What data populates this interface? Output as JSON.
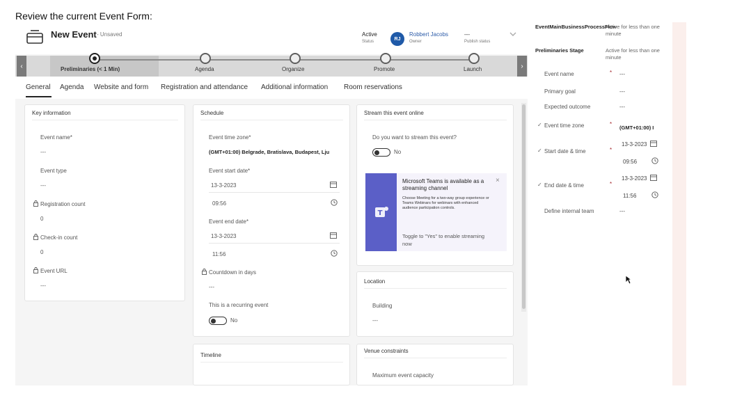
{
  "caption": "Review the current Event Form:",
  "header": {
    "title": "New Event",
    "unsaved": "- Unsaved",
    "status_value": "Active",
    "status_label": "Status",
    "avatar_initials": "RJ",
    "owner_name": "Robbert Jacobs",
    "owner_label": "Owner",
    "publish_value": "---",
    "publish_label": "Publish status"
  },
  "bpf": {
    "stages": [
      {
        "label": "Preliminaries  (< 1 Min)",
        "active": true
      },
      {
        "label": "Agenda",
        "active": false
      },
      {
        "label": "Organize",
        "active": false
      },
      {
        "label": "Promote",
        "active": false
      },
      {
        "label": "Launch",
        "active": false
      }
    ]
  },
  "tabs": [
    "General",
    "Agenda",
    "Website and form",
    "Registration and attendance",
    "Additional information",
    "Room reservations"
  ],
  "key_info": {
    "title": "Key information",
    "event_name_label": "Event name*",
    "event_name_value": "---",
    "event_type_label": "Event type",
    "event_type_value": "---",
    "registration_count_label": "Registration count",
    "registration_count_value": "0",
    "checkin_count_label": "Check-in count",
    "checkin_count_value": "0",
    "event_url_label": "Event URL",
    "event_url_value": "---"
  },
  "schedule": {
    "title": "Schedule",
    "time_zone_label": "Event time zone*",
    "time_zone_value": "(GMT+01:00) Belgrade, Bratislava, Budapest, Lju",
    "start_date_label": "Event start date*",
    "start_date_value": "13-3-2023",
    "start_time_value": "09:56",
    "end_date_label": "Event end date*",
    "end_date_value": "13-3-2023",
    "end_time_value": "11:56",
    "countdown_label": "Countdown in days",
    "countdown_value": "---",
    "recurring_label": "This is a recurring event",
    "recurring_value": "No"
  },
  "timeline": {
    "title": "Timeline"
  },
  "stream": {
    "title": "Stream this event online",
    "question": "Do you want to stream this event?",
    "toggle_value": "No",
    "teams_title": "Microsoft Teams is available as a streaming channel",
    "teams_desc": "Choose Meeting for a two-way group experience or Teams Webinars for webinars with enhanced audience participation controls.",
    "teams_note": "Toggle to \"Yes\" to enable streaming now",
    "close_glyph": "×"
  },
  "location": {
    "title": "Location",
    "building_label": "Building",
    "building_value": "---"
  },
  "venue": {
    "title": "Venue constraints",
    "max_capacity_label": "Maximum event capacity"
  },
  "side": {
    "flow_title": "EventMainBusinessProcessFlow",
    "flow_sub": "Active for less than one minute",
    "stage_title": "Preliminaries Stage",
    "stage_sub": "Active for less than one minute",
    "fields": {
      "event_name_label": "Event name",
      "event_name_value": "---",
      "primary_goal_label": "Primary goal",
      "primary_goal_value": "---",
      "expected_outcome_label": "Expected outcome",
      "expected_outcome_value": "---",
      "time_zone_label": "Event time zone",
      "time_zone_value": "(GMT+01:00) I",
      "start_label": "Start date & time",
      "start_date": "13-3-2023",
      "start_time": "09:56",
      "end_label": "End date & time",
      "end_date": "13-3-2023",
      "end_time": "11:56",
      "internal_team_label": "Define internal team",
      "internal_team_value": "---",
      "required_mark": "*",
      "check_glyph": "✓"
    }
  },
  "colors": {
    "accent": "#1f5aa8",
    "teams": "#5b5fc7",
    "required": "#a4262c"
  }
}
